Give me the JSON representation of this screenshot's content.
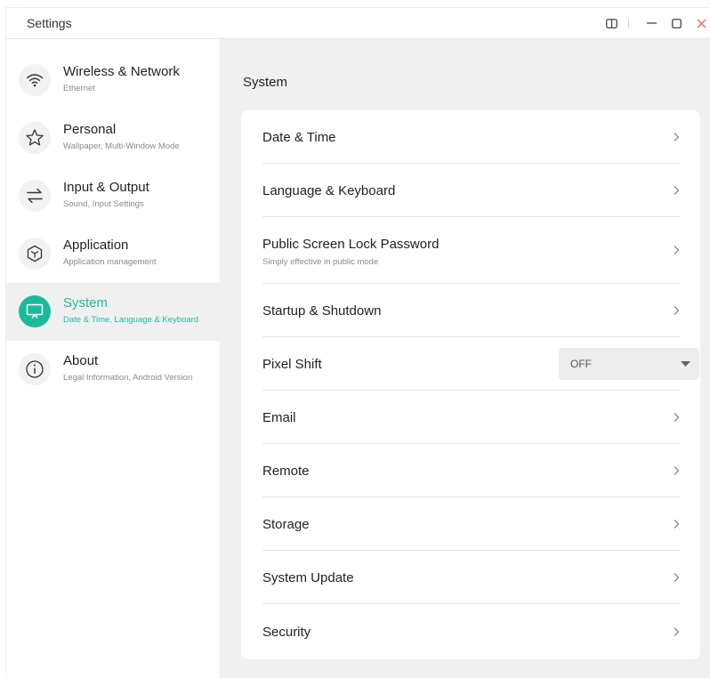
{
  "window": {
    "title": "Settings"
  },
  "sidebar": {
    "items": [
      {
        "title": "Wireless & Network",
        "subtitle": "Ethernet",
        "icon": "wifi-icon"
      },
      {
        "title": "Personal",
        "subtitle": "Wallpaper, Multi-Window Mode",
        "icon": "star-icon"
      },
      {
        "title": "Input & Output",
        "subtitle": "Sound, Input Settings",
        "icon": "arrows-icon"
      },
      {
        "title": "Application",
        "subtitle": "Application management",
        "icon": "cube-icon"
      },
      {
        "title": "System",
        "subtitle": "Date & Time, Language & Keyboard",
        "icon": "monitor-icon",
        "active": true
      },
      {
        "title": "About",
        "subtitle": "Legal Information, Android Version",
        "icon": "info-icon"
      }
    ]
  },
  "main": {
    "section_title": "System",
    "rows": [
      {
        "label": "Date & Time"
      },
      {
        "label": "Language & Keyboard"
      },
      {
        "label": "Public Screen Lock Password",
        "subtitle": "Simply effective in public mode"
      },
      {
        "label": "Startup & Shutdown"
      },
      {
        "label": "Pixel Shift",
        "dropdown_value": "OFF"
      },
      {
        "label": "Email"
      },
      {
        "label": "Remote"
      },
      {
        "label": "Storage"
      },
      {
        "label": "System Update"
      },
      {
        "label": "Security"
      }
    ]
  },
  "colors": {
    "accent": "#1bba9a",
    "close": "#f26b5b",
    "background": "#f0f0f0"
  }
}
